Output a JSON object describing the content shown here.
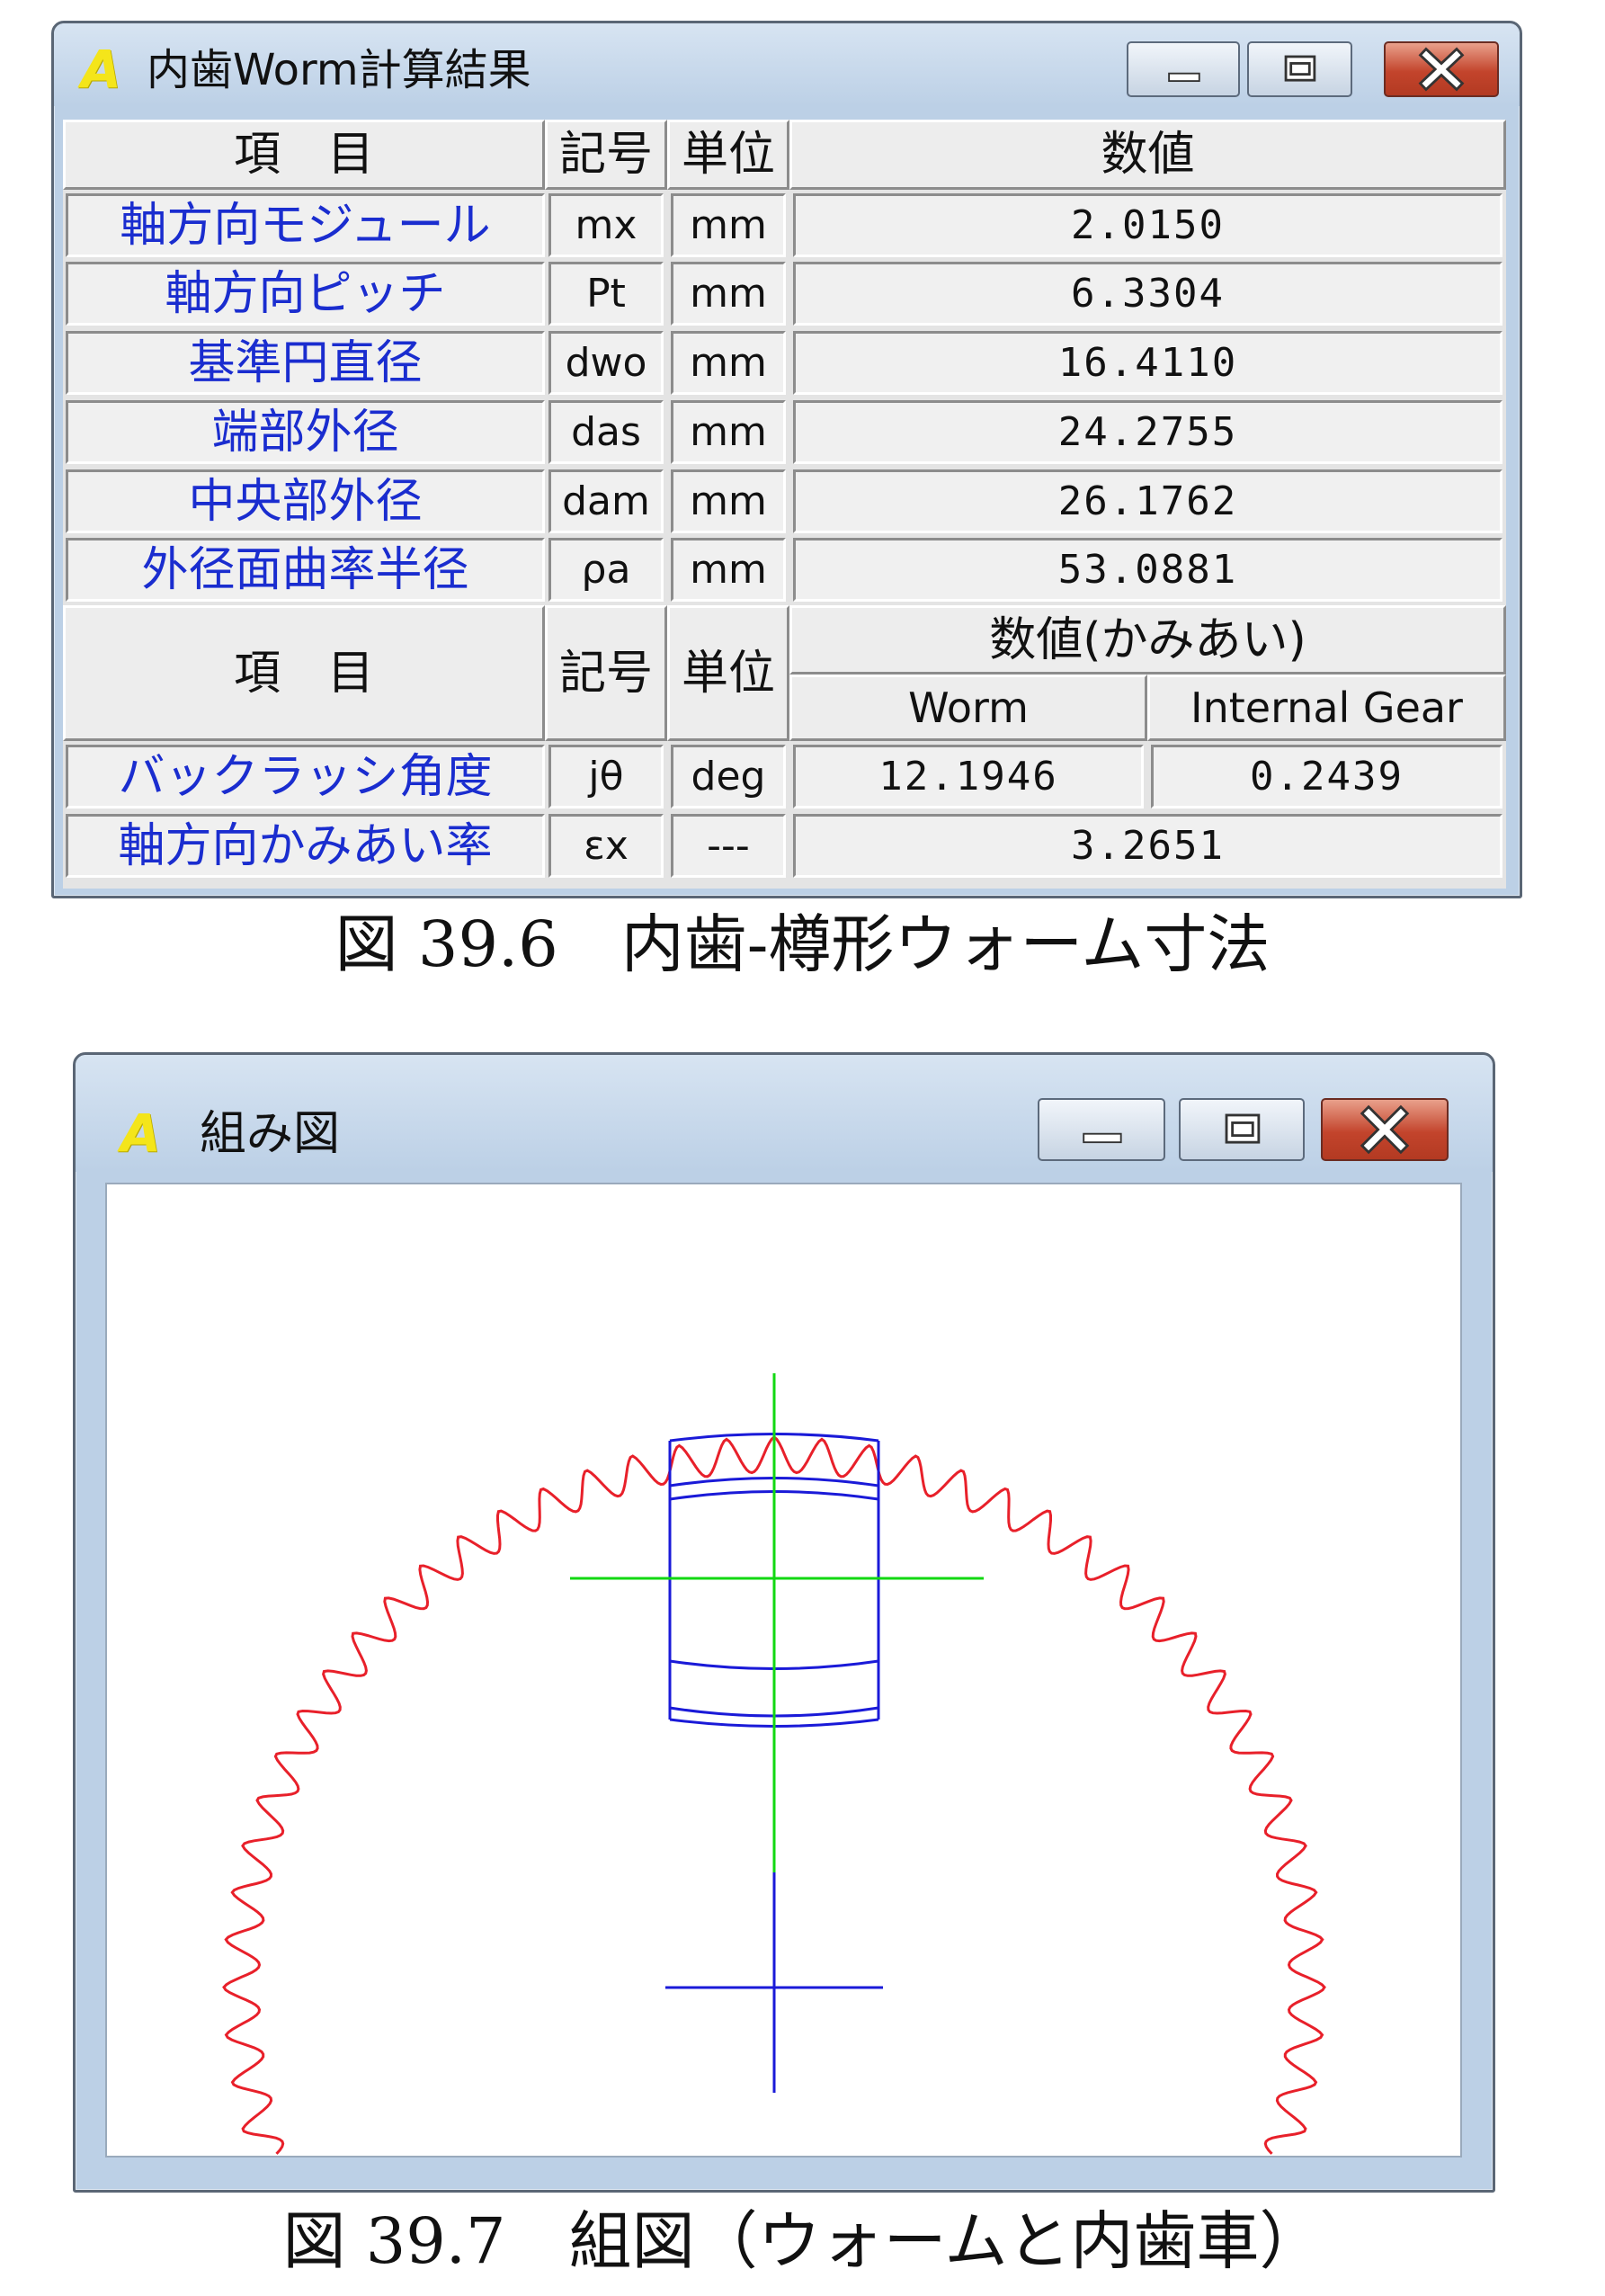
{
  "window1": {
    "icon": "A",
    "title": "内歯Worm計算結果",
    "icons": {
      "minimize": "minimize-icon",
      "maximize": "maximize-icon",
      "close": "close-icon"
    },
    "header": {
      "item": "項　目",
      "symbol": "記号",
      "unit": "単位",
      "value": "数値"
    },
    "rows": [
      {
        "label": "軸方向モジュール",
        "symbol": "mx",
        "unit": "mm",
        "value": "2.0150"
      },
      {
        "label": "軸方向ピッチ",
        "symbol": "Pt",
        "unit": "mm",
        "value": "6.3304"
      },
      {
        "label": "基準円直径",
        "symbol": "dwo",
        "unit": "mm",
        "value": "16.4110"
      },
      {
        "label": "端部外径",
        "symbol": "das",
        "unit": "mm",
        "value": "24.2755"
      },
      {
        "label": "中央部外径",
        "symbol": "dam",
        "unit": "mm",
        "value": "26.1762"
      },
      {
        "label": "外径面曲率半径",
        "symbol": "ρa",
        "unit": "mm",
        "value": "53.0881"
      }
    ],
    "header2": {
      "item": "項　目",
      "symbol": "記号",
      "unit": "単位",
      "value": "数値(かみあい)",
      "worm": "Worm",
      "gear": "Internal Gear"
    },
    "rows2": [
      {
        "label": "バックラッシ角度",
        "symbol": "jθ",
        "unit": "deg",
        "worm": "12.1946",
        "gear": "0.2439"
      },
      {
        "label": "軸方向かみあい率",
        "symbol": "εx",
        "unit": "---",
        "value": "3.2651"
      }
    ]
  },
  "caption1": "図 39.6　内歯-樽形ウォーム寸法",
  "window2": {
    "icon": "A",
    "title": "組み図",
    "colors": {
      "gear": "#e8202a",
      "worm": "#1a1ad8",
      "axis": "#12d812"
    }
  },
  "caption2": "図 39.7　組図（ウォームと内歯車）"
}
